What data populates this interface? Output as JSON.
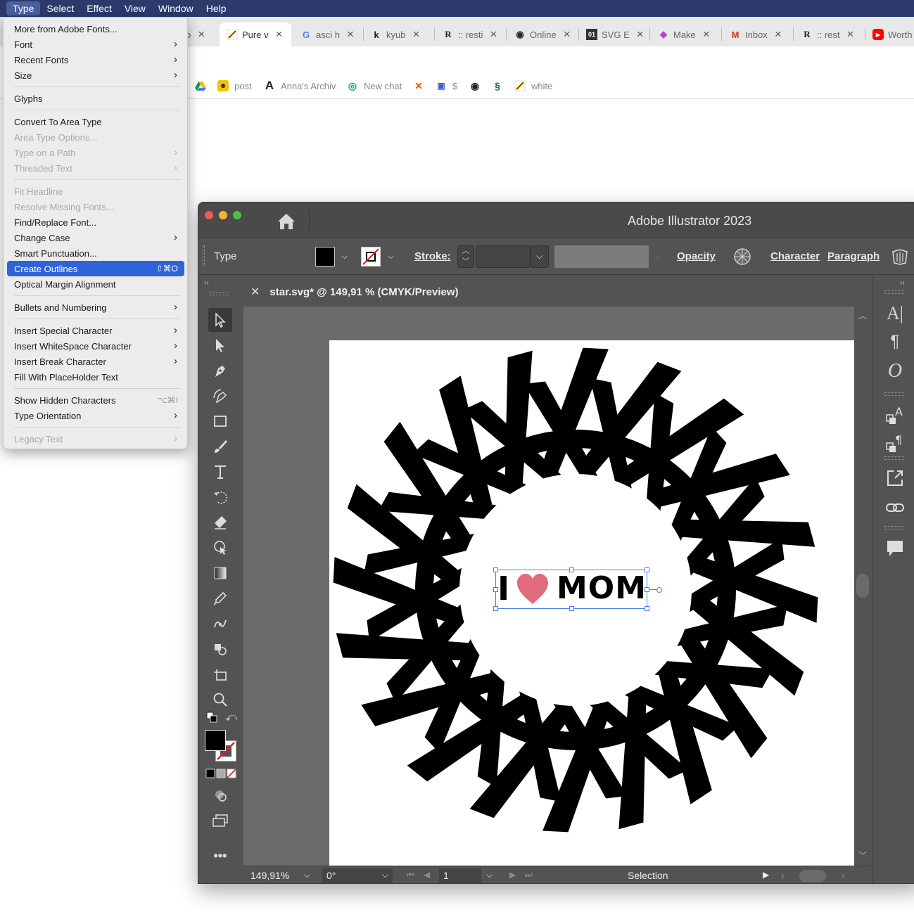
{
  "menubar": {
    "items": [
      "Type",
      "Select",
      "Effect",
      "View",
      "Window",
      "Help"
    ]
  },
  "browser": {
    "tabs": [
      {
        "label": "Pure v",
        "icon": "illustrator-favicon-icon"
      },
      {
        "label": "asci h",
        "icon": "google-favicon-icon"
      },
      {
        "label": "kyub",
        "icon": "kyub-favicon-icon"
      },
      {
        "label": ":: resti",
        "icon": "r-favicon-icon"
      },
      {
        "label": "Online",
        "icon": "globe-favicon-icon"
      },
      {
        "label": "SVG E",
        "icon": "svg-favicon-icon"
      },
      {
        "label": "Make",
        "icon": "make-favicon-icon"
      },
      {
        "label": "Inbox",
        "icon": "gmail-favicon-icon"
      },
      {
        "label": ":: rest",
        "icon": "r-favicon-icon"
      },
      {
        "label": "Worth",
        "icon": "youtube-favicon-icon"
      }
    ],
    "bookmarks": [
      {
        "label": "",
        "icon": "drive-icon"
      },
      {
        "label": "post",
        "icon": "post-icon"
      },
      {
        "label": "Anna's Archiv",
        "icon": "annas-archive-icon"
      },
      {
        "label": "New chat",
        "icon": "chatgpt-icon"
      },
      {
        "label": "",
        "icon": "x-bookmark-icon"
      },
      {
        "label": "$",
        "icon": "dollar-bookmark-icon"
      },
      {
        "label": "",
        "icon": "globe-bookmark-icon"
      },
      {
        "label": "",
        "icon": "s-bookmark-icon"
      },
      {
        "label": "white",
        "icon": "illustrator-bookmark-icon"
      }
    ]
  },
  "type_menu": {
    "items": [
      {
        "label": "More from Adobe Fonts...",
        "disabled": false
      },
      {
        "label": "Font",
        "submenu": true
      },
      {
        "label": "Recent Fonts",
        "submenu": true
      },
      {
        "label": "Size",
        "submenu": true
      },
      {
        "label": "Glyphs"
      },
      {
        "label": "Convert To Area Type"
      },
      {
        "label": "Area Type Options...",
        "disabled": true
      },
      {
        "label": "Type on a Path",
        "disabled": true,
        "submenu": true
      },
      {
        "label": "Threaded Text",
        "disabled": true,
        "submenu": true
      },
      {
        "label": "Fit Headline",
        "disabled": true
      },
      {
        "label": "Resolve Missing Fonts...",
        "disabled": true
      },
      {
        "label": "Find/Replace Font..."
      },
      {
        "label": "Change Case",
        "submenu": true
      },
      {
        "label": "Smart Punctuation..."
      },
      {
        "label": "Create Outlines",
        "shortcut": "⇧⌘O",
        "selected": true
      },
      {
        "label": "Optical Margin Alignment"
      },
      {
        "label": "Bullets and Numbering",
        "submenu": true
      },
      {
        "label": "Insert Special Character",
        "submenu": true
      },
      {
        "label": "Insert WhiteSpace Character",
        "submenu": true
      },
      {
        "label": "Insert Break Character",
        "submenu": true
      },
      {
        "label": "Fill With PlaceHolder Text"
      },
      {
        "label": "Show Hidden Characters",
        "shortcut": "⌥⌘I"
      },
      {
        "label": "Type Orientation",
        "submenu": true
      },
      {
        "label": "Legacy Text",
        "disabled": true,
        "submenu": true
      }
    ]
  },
  "illustrator": {
    "app_title": "Adobe Illustrator 2023",
    "control_bar": {
      "selection_label": "Type",
      "stroke_label": "Stroke:",
      "opacity_label": "Opacity",
      "character_label": "Character",
      "paragraph_label": "Paragraph"
    },
    "document_tab": "star.svg* @ 149,91 % (CMYK/Preview)",
    "artwork_text": {
      "left": "I",
      "right": "MOM"
    },
    "status_bar": {
      "zoom": "149,91%",
      "rotation": "0°",
      "artboard": "1",
      "tool": "Selection"
    },
    "colors": {
      "heart": "#e06b7e",
      "selection": "#4a7cf0",
      "menu_highlight": "#2e63d9",
      "menubar": "#2b3a6b"
    }
  }
}
